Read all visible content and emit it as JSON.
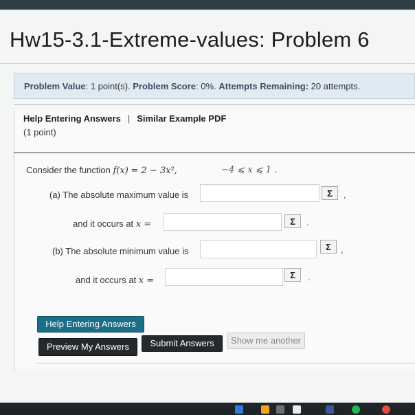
{
  "page": {
    "title": "Hw15-3.1-Extreme-values: Problem 6"
  },
  "info": {
    "value_label": "Problem Value",
    "value": "1 point(s).",
    "score_label": "Problem Score",
    "score": "0%.",
    "attempts_label": "Attempts Remaining:",
    "attempts": "20 attempts."
  },
  "help": {
    "entering_link": "Help Entering Answers",
    "separator": "|",
    "example_link": "Similar Example PDF",
    "points": "(1 point)"
  },
  "problem": {
    "intro": "Consider the function",
    "function_lhs": "f(x)",
    "function_rhs": "= 2 − 3x²,",
    "domain": "−4 ⩽ x ⩽ 1 .",
    "part_a_label": "(a) The absolute maximum value is",
    "part_a_occurs": "and it occurs at",
    "part_b_label": "(b) The absolute minimum value is",
    "part_b_occurs": "and it occurs at",
    "x_eq": "x =",
    "sigma": "Σ",
    "comma": ",",
    "period": "."
  },
  "answers": {
    "max_value": "",
    "max_x": "",
    "min_value": "",
    "min_x": ""
  },
  "buttons": {
    "help_entering": "Help Entering Answers",
    "preview": "Preview My Answers",
    "submit": "Submit Answers",
    "show_another": "Show me another"
  },
  "taskbar": {
    "icon_colors": [
      "#2d7de0",
      "#f7a21b",
      "#6e6e6e",
      "#e9e9e9",
      "#3b5998",
      "#1db954",
      "#e24c3f"
    ]
  }
}
